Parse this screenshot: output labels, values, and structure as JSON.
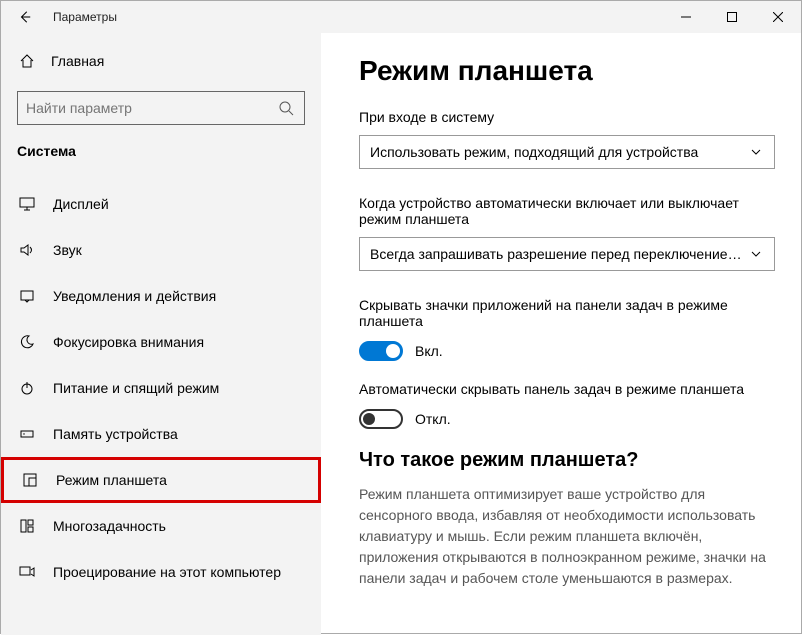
{
  "window": {
    "title": "Параметры"
  },
  "sidebar": {
    "home": "Главная",
    "search_placeholder": "Найти параметр",
    "group": "Система",
    "items": [
      {
        "label": "Дисплей"
      },
      {
        "label": "Звук"
      },
      {
        "label": "Уведомления и действия"
      },
      {
        "label": "Фокусировка внимания"
      },
      {
        "label": "Питание и спящий режим"
      },
      {
        "label": "Память устройства"
      },
      {
        "label": "Режим планшета",
        "highlighted": true
      },
      {
        "label": "Многозадачность"
      },
      {
        "label": "Проецирование на этот компьютер"
      }
    ]
  },
  "main": {
    "heading": "Режим планшета",
    "signin_label": "При входе в систему",
    "signin_value": "Использовать режим, подходящий для устройства",
    "auto_label": "Когда устройство автоматически включает или выключает режим планшета",
    "auto_value": "Всегда запрашивать разрешение перед переключением р...",
    "hide_icons_label": "Скрывать значки приложений на панели задач в режиме планшета",
    "hide_icons_state": "Вкл.",
    "autohide_label": "Автоматически скрывать панель задач в режиме планшета",
    "autohide_state": "Откл.",
    "about_heading": "Что такое режим планшета?",
    "about_body": "Режим планшета оптимизирует ваше устройство для сенсорного ввода, избавляя от необходимости использовать клавиатуру и мышь. Если режим планшета включён, приложения открываются в полноэкранном режиме, значки на панели задач и рабочем столе уменьшаются в размерах."
  }
}
